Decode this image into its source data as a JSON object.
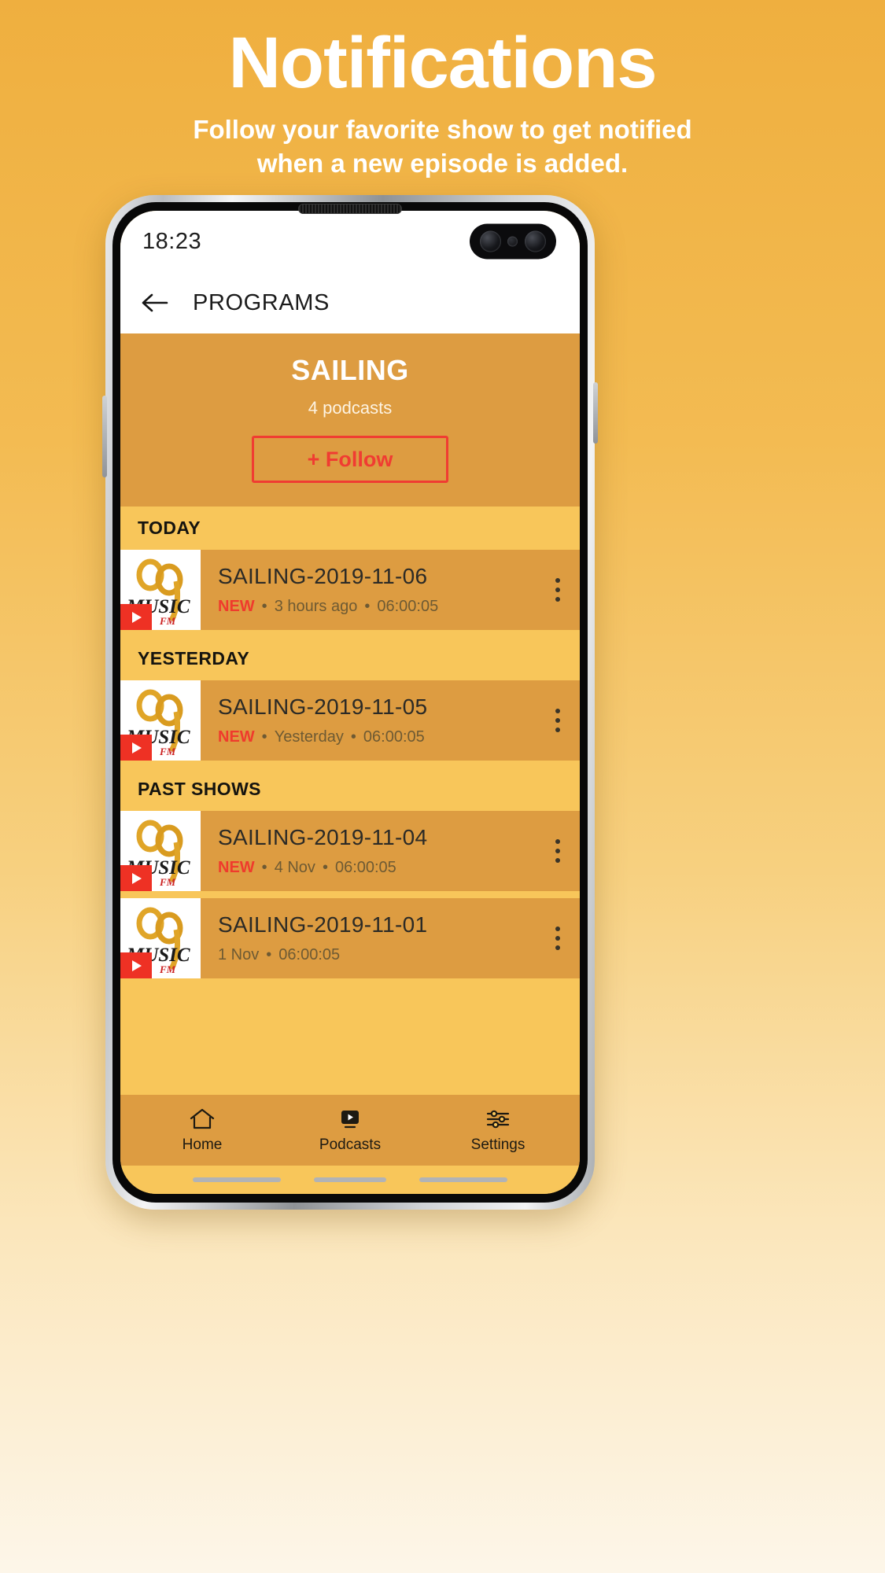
{
  "promo": {
    "title": "Notifications",
    "subtitle_line1": "Follow your favorite show to get notified",
    "subtitle_line2": "when a new episode is added."
  },
  "colors": {
    "background_top": "#efaf3f",
    "accent_red": "#f03c32",
    "hero_bg": "#dd9c41",
    "list_bg": "#f8c65a"
  },
  "statusbar": {
    "time": "18:23"
  },
  "appbar": {
    "back_icon": "arrow-left-icon",
    "title": "PROGRAMS"
  },
  "hero": {
    "title": "SAILING",
    "count": "4 podcasts",
    "follow_label": "+ Follow"
  },
  "sections": [
    {
      "heading": "TODAY",
      "items": [
        {
          "title": "SAILING-2019-11-06",
          "badge": "NEW",
          "separator1": "•",
          "time_ago": "3 hours ago",
          "separator2": "•",
          "duration": "06:00:05",
          "thumb_alt": "99-music-fm-logo",
          "play_icon": "play-icon",
          "menu_icon": "kebab-menu-icon"
        }
      ]
    },
    {
      "heading": "YESTERDAY",
      "items": [
        {
          "title": "SAILING-2019-11-05",
          "badge": "NEW",
          "separator1": "•",
          "time_ago": "Yesterday",
          "separator2": "•",
          "duration": "06:00:05",
          "thumb_alt": "99-music-fm-logo",
          "play_icon": "play-icon",
          "menu_icon": "kebab-menu-icon"
        }
      ]
    },
    {
      "heading": "PAST SHOWS",
      "items": [
        {
          "title": "SAILING-2019-11-04",
          "badge": "NEW",
          "separator1": "•",
          "time_ago": "4 Nov",
          "separator2": "•",
          "duration": "06:00:05",
          "thumb_alt": "99-music-fm-logo",
          "play_icon": "play-icon",
          "menu_icon": "kebab-menu-icon"
        },
        {
          "title": "SAILING-2019-11-01",
          "badge": "",
          "separator1": "",
          "time_ago": "1 Nov",
          "separator2": "•",
          "duration": "06:00:05",
          "thumb_alt": "99-music-fm-logo",
          "play_icon": "play-icon",
          "menu_icon": "kebab-menu-icon"
        }
      ]
    }
  ],
  "bottomnav": [
    {
      "label": "Home",
      "icon": "home-icon"
    },
    {
      "label": "Podcasts",
      "icon": "podcasts-icon"
    },
    {
      "label": "Settings",
      "icon": "sliders-icon"
    }
  ]
}
